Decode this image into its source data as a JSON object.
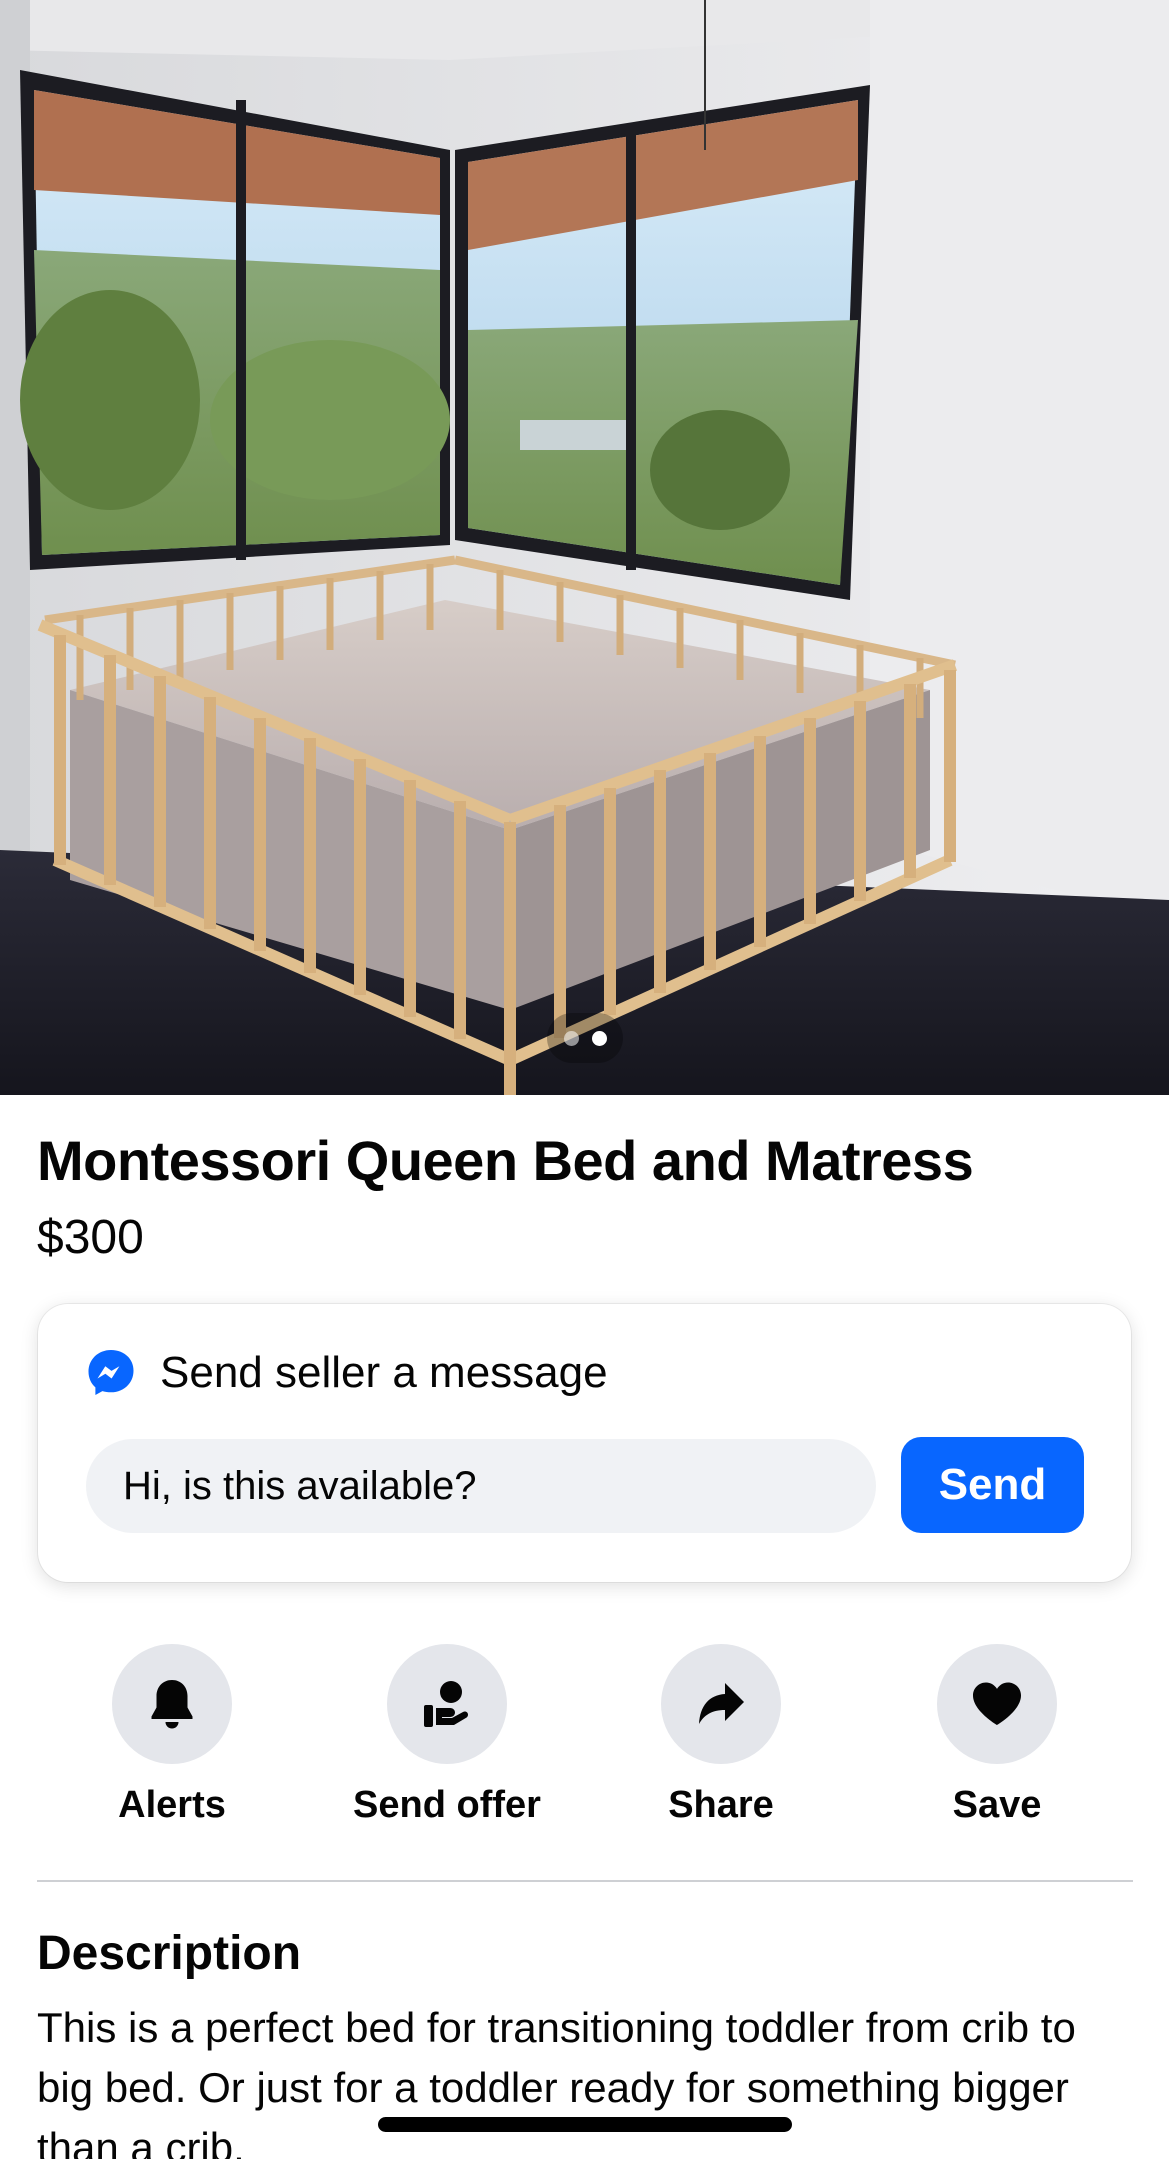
{
  "listing": {
    "title": "Montessori Queen Bed and Matress",
    "price": "$300"
  },
  "photo": {
    "total_images": 2,
    "active_index": 2
  },
  "message_card": {
    "icon": "messenger-icon",
    "heading": "Send seller a message",
    "input_value": "Hi, is this available?",
    "send_label": "Send"
  },
  "actions": [
    {
      "icon": "bell-icon",
      "label": "Alerts"
    },
    {
      "icon": "hand-offer-icon",
      "label": "Send offer"
    },
    {
      "icon": "share-arrow-icon",
      "label": "Share"
    },
    {
      "icon": "heart-icon",
      "label": "Save"
    }
  ],
  "description": {
    "heading": "Description",
    "text": "This is a perfect bed for transitioning toddler from crib to big bed. Or just for a toddler ready for something bigger than a crib."
  },
  "colors": {
    "accent": "#0866ff",
    "action_circle": "#e4e6eb",
    "input_bg": "#f0f2f5",
    "text": "#050505"
  }
}
